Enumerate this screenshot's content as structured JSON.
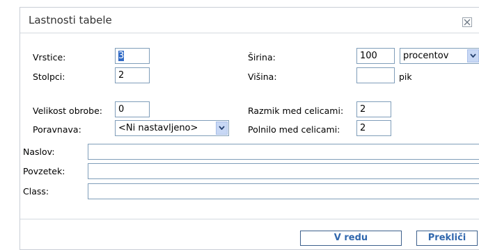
{
  "dialog": {
    "title": "Lastnosti tabele",
    "close_icon": "close-icon"
  },
  "fields": {
    "rows_label": "Vrstice:",
    "rows_value": "3",
    "cols_label": "Stolpci:",
    "cols_value": "2",
    "width_label": "Širina:",
    "width_value": "100",
    "width_unit_selected": "procentov",
    "height_label": "Višina:",
    "height_value": "",
    "height_unit": "pik",
    "border_label": "Velikost obrobe:",
    "border_value": "0",
    "align_label": "Poravnava:",
    "align_selected": "<Ni nastavljeno>",
    "spacing_label": "Razmik med celicami:",
    "spacing_value": "2",
    "padding_label": "Polnilo med celicami:",
    "padding_value": "2",
    "caption_label": "Naslov:",
    "caption_value": "",
    "summary_label": "Povzetek:",
    "summary_value": "",
    "class_label": "Class:",
    "class_value": ""
  },
  "buttons": {
    "ok": "V redu",
    "cancel": "Prekliči"
  },
  "colors": {
    "input_border": "#7f9db9",
    "selection": "#316ac5",
    "button_text": "#3067ad"
  }
}
